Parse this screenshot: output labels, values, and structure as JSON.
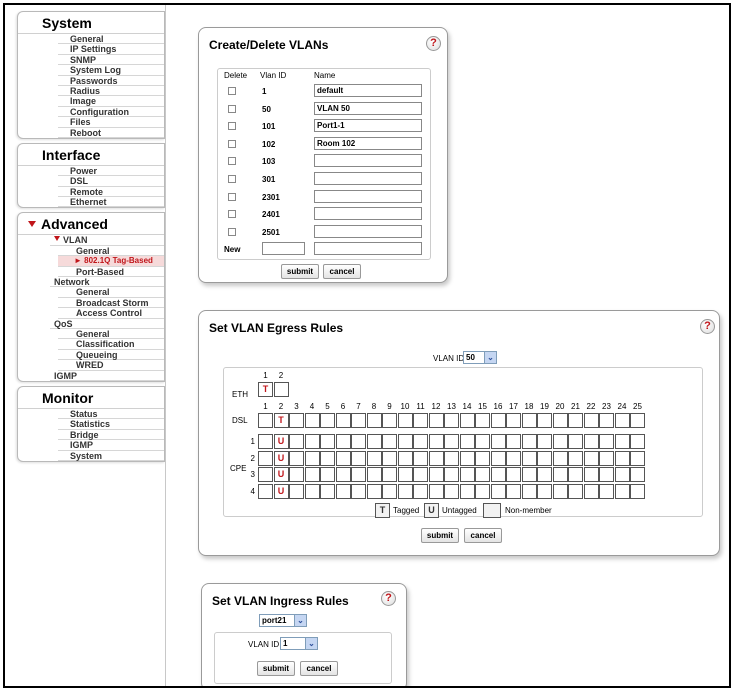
{
  "sidebar": {
    "system": {
      "title": "System",
      "items": [
        "General",
        "IP Settings",
        "SNMP",
        "System Log",
        "Passwords",
        "Radius",
        "Image",
        "Configuration",
        "Files",
        "Reboot"
      ]
    },
    "interface": {
      "title": "Interface",
      "items": [
        "Power",
        "DSL",
        "Remote",
        "Ethernet"
      ]
    },
    "advanced": {
      "title": "Advanced",
      "vlan": "VLAN",
      "vlan_items": [
        "General",
        "802.1Q Tag-Based",
        "Port-Based"
      ],
      "network": "Network",
      "network_items": [
        "General",
        "Broadcast Storm",
        "Access Control"
      ],
      "qos": "QoS",
      "qos_items": [
        "General",
        "Classification",
        "Queueing",
        "WRED"
      ],
      "igmp": "IGMP"
    },
    "monitor": {
      "title": "Monitor",
      "items": [
        "Status",
        "Statistics",
        "Bridge",
        "IGMP",
        "System"
      ]
    }
  },
  "create": {
    "title": "Create/Delete VLANs",
    "help": "?",
    "col_delete": "Delete",
    "col_id": "Vlan ID",
    "col_name": "Name",
    "rows": [
      {
        "id": "1",
        "name": "default"
      },
      {
        "id": "50",
        "name": "VLAN 50"
      },
      {
        "id": "101",
        "name": "Port1-1"
      },
      {
        "id": "102",
        "name": "Room 102"
      },
      {
        "id": "103",
        "name": ""
      },
      {
        "id": "301",
        "name": ""
      },
      {
        "id": "2301",
        "name": ""
      },
      {
        "id": "2401",
        "name": ""
      },
      {
        "id": "2501",
        "name": ""
      }
    ],
    "new_label": "New",
    "submit": "submit",
    "cancel": "cancel"
  },
  "egress": {
    "title": "Set VLAN Egress Rules",
    "help": "?",
    "vlan_label": "VLAN ID:",
    "vlan_value": "50",
    "eth_label": "ETH",
    "dsl_label": "DSL",
    "cpe_label": "CPE",
    "eth_ports": [
      "1",
      "2"
    ],
    "eth_values": [
      "T",
      ""
    ],
    "ports": [
      "1",
      "2",
      "3",
      "4",
      "5",
      "6",
      "7",
      "8",
      "9",
      "10",
      "11",
      "12",
      "13",
      "14",
      "15",
      "16",
      "17",
      "18",
      "19",
      "20",
      "21",
      "22",
      "23",
      "24",
      "25"
    ],
    "dsl_values": {
      "2": "T"
    },
    "cpe_rows": [
      "1",
      "2",
      "3",
      "4"
    ],
    "cpe_values": {
      "2": "U"
    },
    "legend_tagged_sym": "T",
    "legend_tagged": "Tagged",
    "legend_untagged_sym": "U",
    "legend_untagged": "Untagged",
    "legend_nonmember": "Non-member",
    "submit": "submit",
    "cancel": "cancel"
  },
  "ingress": {
    "title": "Set VLAN Ingress Rules",
    "help": "?",
    "port_value": "port21",
    "vlan_label": "VLAN ID",
    "vlan_value": "1",
    "submit": "submit",
    "cancel": "cancel"
  },
  "colors": {
    "accent": "#c0151a",
    "selected_bg": "#f6dada"
  }
}
